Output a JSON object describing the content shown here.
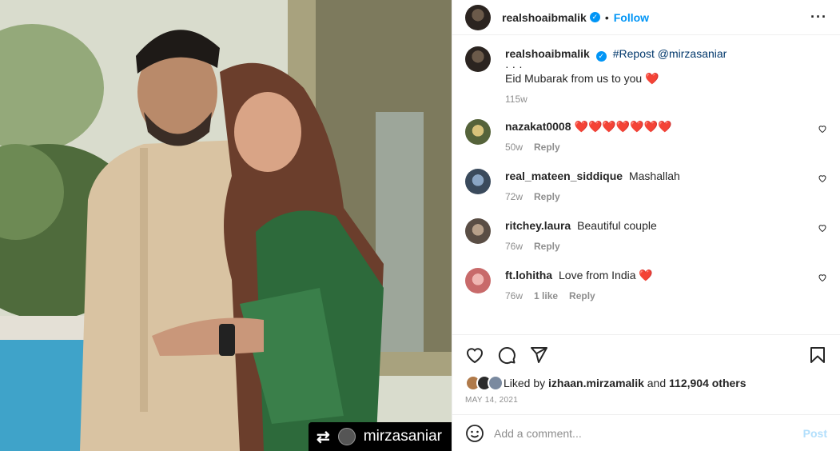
{
  "header": {
    "username": "realshoaibmalik",
    "follow_label": "Follow",
    "dot": "•",
    "more": "···"
  },
  "caption": {
    "username": "realshoaibmalik",
    "repost_tag": "#Repost",
    "mention": "@mirzasaniar",
    "dots": "·  ·  ·",
    "text": "Eid Mubarak from us to you",
    "emoji": "❤️",
    "time": "115w"
  },
  "comments": [
    {
      "username": "nazakat0008",
      "text": "",
      "emoji": "❤️❤️❤️❤️❤️❤️❤️",
      "time": "50w",
      "likes": "",
      "reply": "Reply"
    },
    {
      "username": "real_mateen_siddique",
      "text": "Mashallah",
      "emoji": "",
      "time": "72w",
      "likes": "",
      "reply": "Reply"
    },
    {
      "username": "ritchey.laura",
      "text": "Beautiful couple",
      "emoji": "",
      "time": "76w",
      "likes": "",
      "reply": "Reply"
    },
    {
      "username": "ft.lohitha",
      "text": "Love from India",
      "emoji": "❤️",
      "time": "76w",
      "likes": "1 like",
      "reply": "Reply"
    }
  ],
  "likes": {
    "prefix": "Liked by",
    "user": "izhaan.mirzamalik",
    "and": "and",
    "count": "112,904 others"
  },
  "date": "MAY 14, 2021",
  "composer": {
    "placeholder": "Add a comment...",
    "post_label": "Post"
  },
  "watermark": {
    "handle": "mirzasaniar"
  },
  "colors": {
    "accent": "#0095f6",
    "heart": "#ed4956",
    "text": "#262626",
    "muted": "#8e8e8e"
  }
}
